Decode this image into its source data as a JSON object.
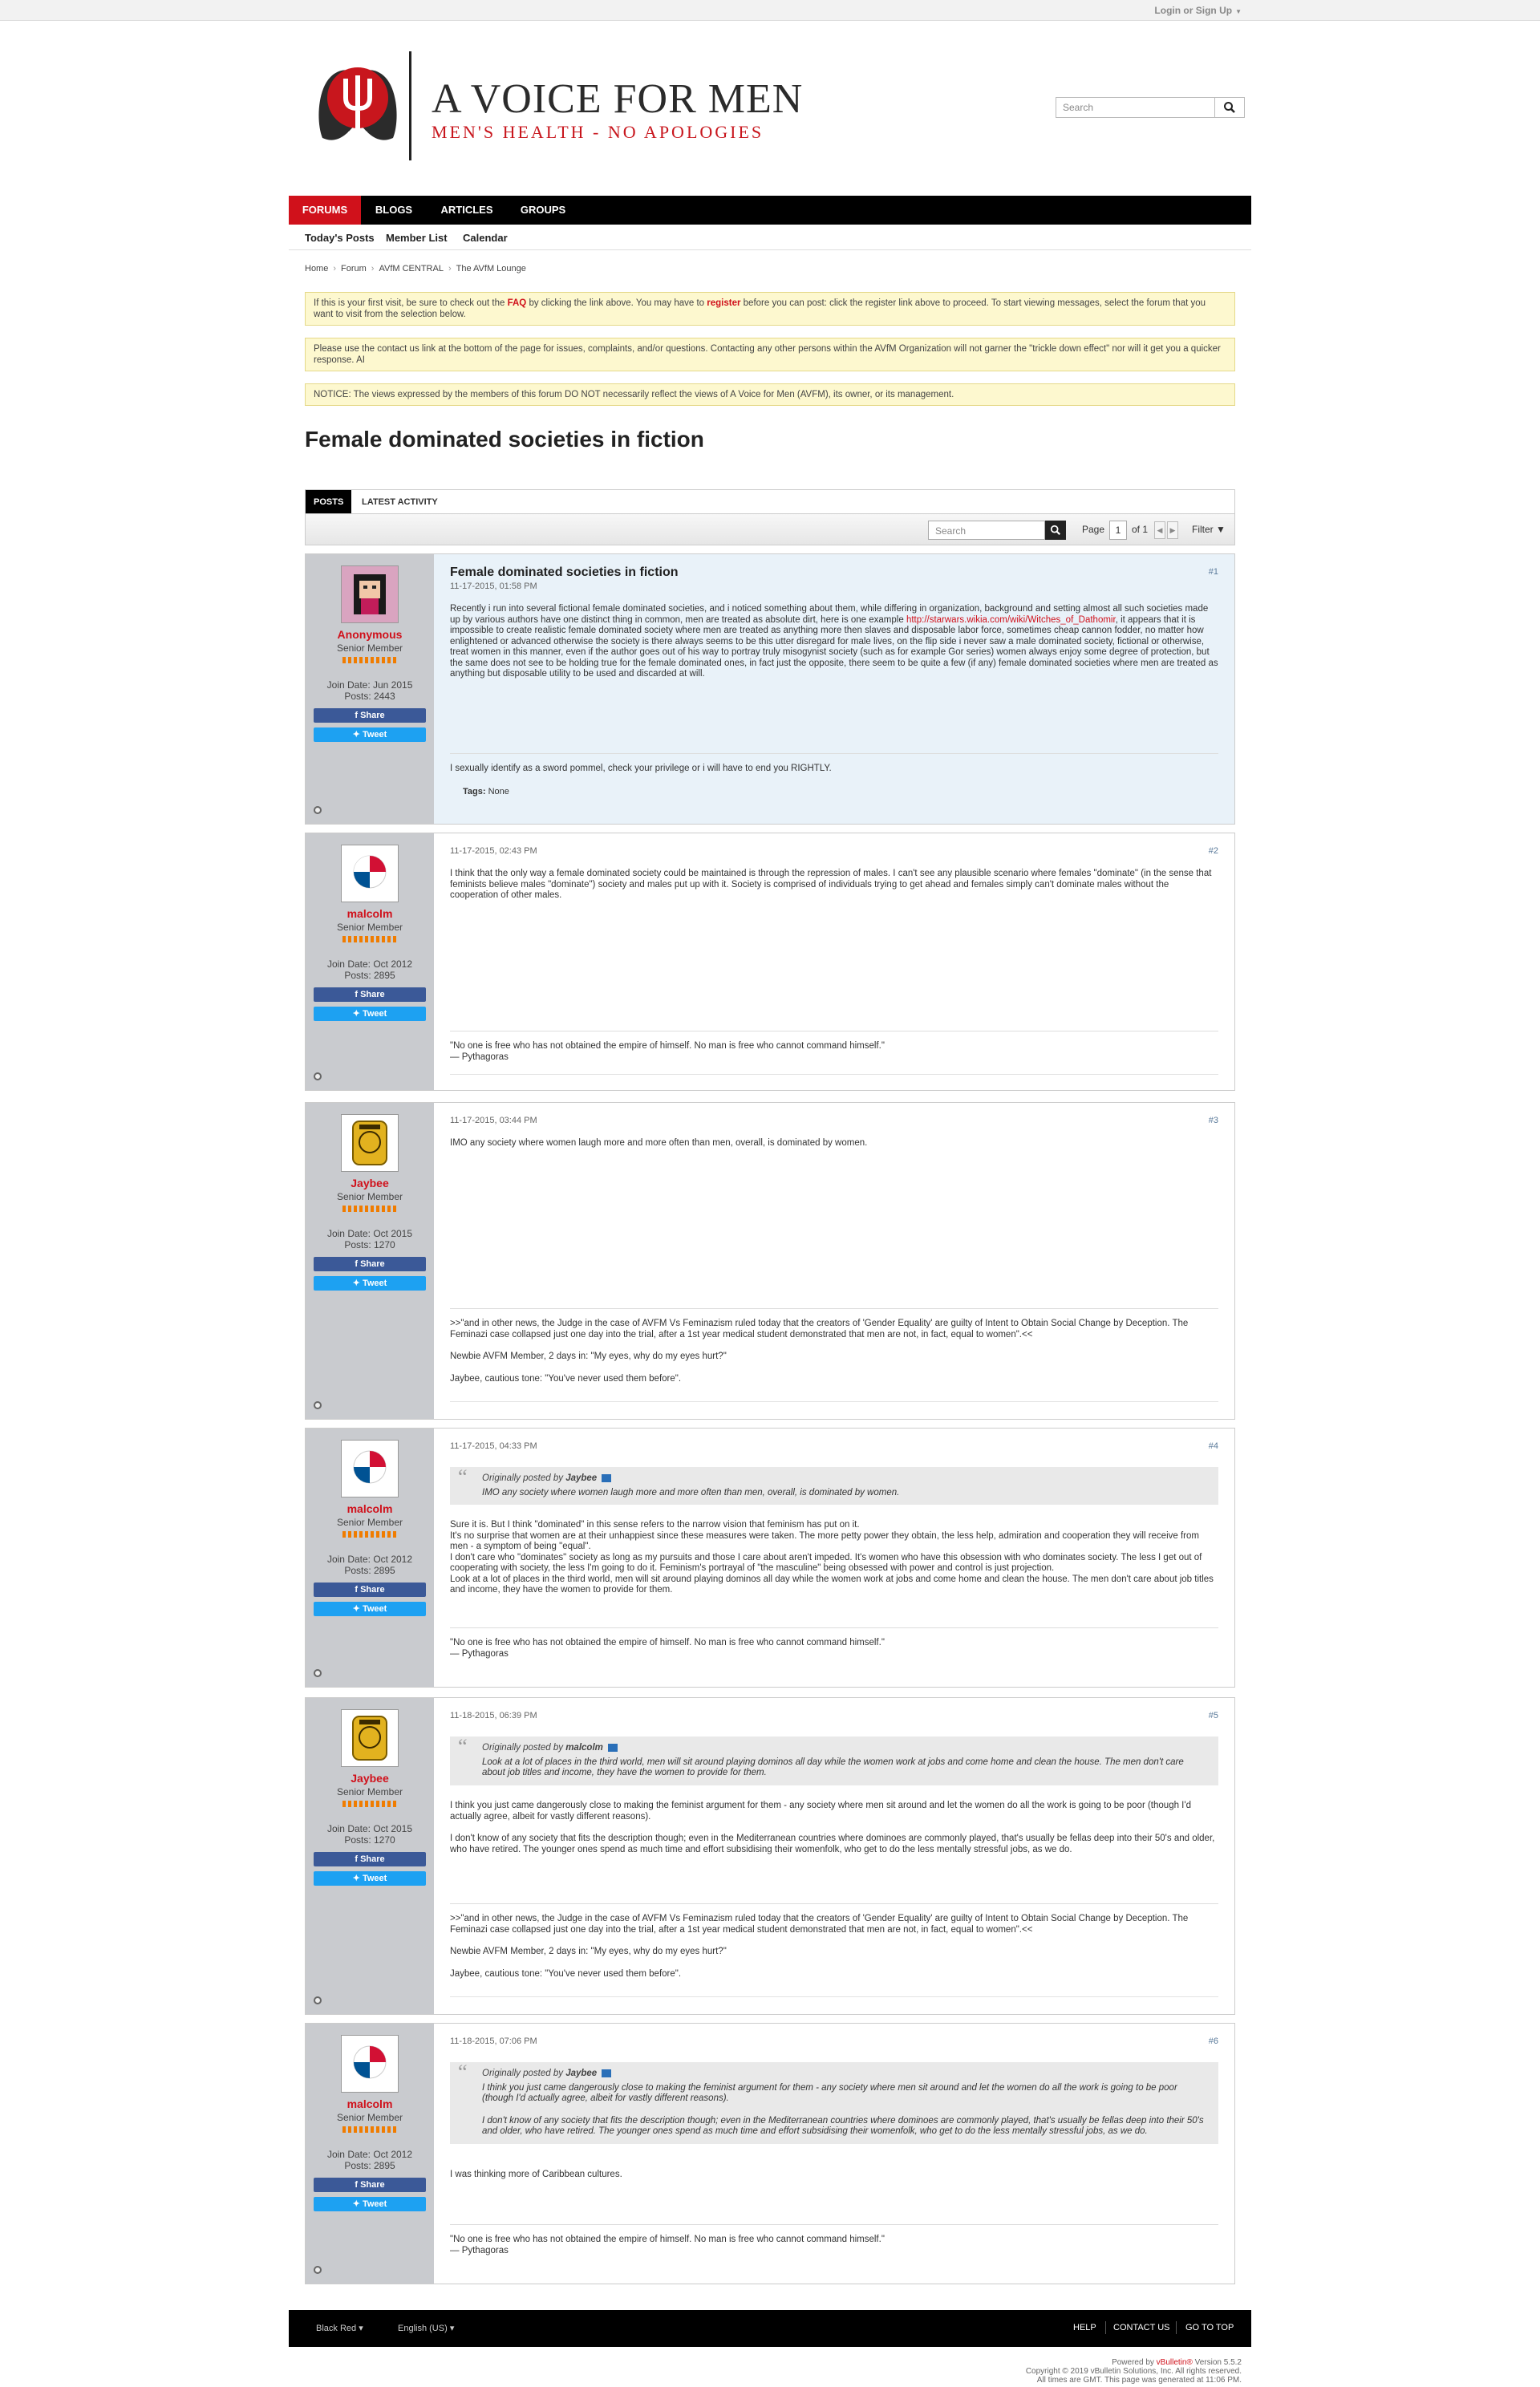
{
  "topbar": {
    "login": "Login or Sign Up"
  },
  "header": {
    "site_name": "A VOICE FOR MEN",
    "tagline": "MEN'S HEALTH - NO APOLOGIES",
    "search_placeholder": "Search"
  },
  "nav": {
    "items": [
      "FORUMS",
      "BLOGS",
      "ARTICLES",
      "GROUPS"
    ],
    "sub": [
      "Today's Posts",
      "Member List",
      "Calendar"
    ]
  },
  "breadcrumb": [
    "Home",
    "Forum",
    "AVfM CENTRAL",
    "The AVfM Lounge"
  ],
  "notices": {
    "n1_a": "If this is your first visit, be sure to check out the ",
    "n1_faq": "FAQ",
    "n1_b": " by clicking the link above. You may have to ",
    "n1_register": "register",
    "n1_c": " before you can post: click the register link above to proceed. To start viewing messages, select the forum that you want to visit from the selection below.",
    "n2": "Please use the contact us link at the bottom of the page for issues, complaints, and/or questions. Contacting any other persons within the AVfM Organization will not garner the \"trickle down effect\" nor will it get you a quicker response. AI",
    "n3": "NOTICE: The views expressed by the members of this forum DO NOT necessarily reflect the views of A Voice for Men (AVFM), its owner, or its management."
  },
  "thread_title": "Female dominated societies in fiction",
  "tabs": [
    "POSTS",
    "LATEST ACTIVITY"
  ],
  "toolbar": {
    "search_placeholder": "Search",
    "page_label": "Page",
    "page_value": "1",
    "of_label": "of 1",
    "filter": "Filter"
  },
  "posts": [
    {
      "user": "Anonymous",
      "rank": "Senior Member",
      "join": "Join Date: Jun 2015",
      "count": "Posts: 2443",
      "title": "Female dominated societies in fiction",
      "date": "11-17-2015, 01:58 PM",
      "num": "#1",
      "body_a": "Recently i run into several fictional female dominated societies, and i noticed something about them, while differing in organization, background and setting almost all such societies made up by various authors have one distinct thing in common, men are treated as absolute dirt, here is one example ",
      "body_link": "http://starwars.wikia.com/wiki/Witches_of_Dathomir",
      "body_b": ", it appears that it is impossible to create realistic female dominated society where men are treated as anything more then slaves and disposable labor force, sometimes cheap cannon fodder, no matter how enlightened or advanced otherwise the society is there always seems to be this utter disregard for male lives, on the flip side i never saw a male dominated society, fictional or otherwise, treat women in this manner, even if the author goes out of his way to portray truly misogynist society (such as for example Gor series) women always enjoy some degree of protection, but the same does not see to be holding true for the female dominated ones, in fact just the opposite, there seem to be quite a few (if any) female dominated societies where men are treated as anything but disposable utility to be used and discarded at will.",
      "sig": "I sexually identify as a sword pommel, check your privilege or i will have to end you RIGHTLY.",
      "tags_label": "Tags:",
      "tags_value": "None"
    },
    {
      "user": "malcolm",
      "rank": "Senior Member",
      "join": "Join Date: Oct 2012",
      "count": "Posts: 2895",
      "date": "11-17-2015, 02:43 PM",
      "num": "#2",
      "body": "I think that the only way a female dominated society could be maintained is through the repression of males. I can't see any plausible scenario where females \"dominate\" (in the sense that feminists believe males \"dominate\") society and males put up with it. Society is comprised of individuals trying to get ahead and females simply can't dominate males without the cooperation of other males.",
      "sig1": "\"No one is free who has not obtained the empire of himself. No man is free who cannot command himself.\"",
      "sig2": "— Pythagoras"
    },
    {
      "user": "Jaybee",
      "rank": "Senior Member",
      "join": "Join Date: Oct 2015",
      "count": "Posts: 1270",
      "date": "11-17-2015, 03:44 PM",
      "num": "#3",
      "body": "IMO any society where women laugh more and more often than men, overall, is dominated by women.",
      "sig1": ">>\"and in other news, the Judge in the case of AVFM Vs Feminazism ruled today that the creators of 'Gender Equality' are guilty of Intent to Obtain Social Change by Deception. The Feminazi case collapsed just one day into the trial, after a 1st year medical student demonstrated that men are not, in fact, equal to women\".<<",
      "sig2": "Newbie AVFM Member, 2 days in: \"My eyes, why do my eyes hurt?\"",
      "sig3": "Jaybee, cautious tone: \"You've never used them before\"."
    },
    {
      "user": "malcolm",
      "rank": "Senior Member",
      "join": "Join Date: Oct 2012",
      "count": "Posts: 2895",
      "date": "11-17-2015, 04:33 PM",
      "num": "#4",
      "quote_prefix": "Originally posted by",
      "quote_user": "Jaybee",
      "quote_text": "IMO any society where women laugh more and more often than men, overall, is dominated by women.",
      "body1": "Sure it is. But I think \"dominated\" in this sense refers to the narrow vision that feminism has put on it.",
      "body2": "It's no surprise that women are at their unhappiest since these measures were taken. The more petty power they obtain, the less help, admiration and cooperation they will receive from men - a symptom of being \"equal\".",
      "body3": "I don't care who \"dominates\" society as long as my pursuits and those I care about aren't impeded. It's women who have this obsession with who dominates society. The less I get out of cooperating with society, the less I'm going to do it. Feminism's portrayal of \"the masculine\" being obsessed with power and control is just projection.",
      "body4": "Look at a lot of places in the third world, men will sit around playing dominos all day while the women work at jobs and come home and clean the house. The men don't care about job titles and income, they have the women to provide for them.",
      "sig1": "\"No one is free who has not obtained the empire of himself. No man is free who cannot command himself.\"",
      "sig2": "— Pythagoras"
    },
    {
      "user": "Jaybee",
      "rank": "Senior Member",
      "join": "Join Date: Oct 2015",
      "count": "Posts: 1270",
      "date": "11-18-2015, 06:39 PM",
      "num": "#5",
      "quote_prefix": "Originally posted by",
      "quote_user": "malcolm",
      "quote_text": "Look at a lot of places in the third world, men will sit around playing dominos all day while the women work at jobs and come home and clean the house. The men don't care about job titles and income, they have the women to provide for them.",
      "body1": "I think you just came dangerously close to making the feminist argument for them - any society where men sit around and let the women do all the work is going to be poor (though I'd actually agree, albeit for vastly different reasons).",
      "body2": "I don't know of any society that fits the description though; even in the Mediterranean countries where dominoes are commonly played, that's usually be fellas deep into their 50's and older, who have retired. The younger ones spend as much time and effort subsidising their womenfolk, who get to do the less mentally stressful jobs, as we do.",
      "sig1": ">>\"and in other news, the Judge in the case of AVFM Vs Feminazism ruled today that the creators of 'Gender Equality' are guilty of Intent to Obtain Social Change by Deception. The Feminazi case collapsed just one day into the trial, after a 1st year medical student demonstrated that men are not, in fact, equal to women\".<<",
      "sig2": "Newbie AVFM Member, 2 days in: \"My eyes, why do my eyes hurt?\"",
      "sig3": "Jaybee, cautious tone: \"You've never used them before\"."
    },
    {
      "user": "malcolm",
      "rank": "Senior Member",
      "join": "Join Date: Oct 2012",
      "count": "Posts: 2895",
      "date": "11-18-2015, 07:06 PM",
      "num": "#6",
      "quote_prefix": "Originally posted by",
      "quote_user": "Jaybee",
      "quote_text1": "I think you just came dangerously close to making the feminist argument for them - any society where men sit around and let the women do all the work is going to be poor (though I'd actually agree, albeit for vastly different reasons).",
      "quote_text2": "I don't know of any society that fits the description though; even in the Mediterranean countries where dominoes are commonly played, that's usually be fellas deep into their 50's and older, who have retired. The younger ones spend as much time and effort subsidising their womenfolk, who get to do the less mentally stressful jobs, as we do.",
      "body1": "I was thinking more of Caribbean cultures.",
      "sig1": "\"No one is free who has not obtained the empire of himself. No man is free who cannot command himself.\"",
      "sig2": "— Pythagoras"
    }
  ],
  "share_label": "Share",
  "tweet_label": "Tweet",
  "footer": {
    "style": "Black Red",
    "lang": "English (US)",
    "help": "HELP",
    "contact": "CONTACT US",
    "top": "GO TO TOP",
    "powered_a": "Powered by ",
    "powered_link": "vBulletin®",
    "powered_b": " Version 5.5.2",
    "copyright": "Copyright © 2019 vBulletin Solutions, Inc. All rights reserved.",
    "times": "All times are GMT. This page was generated at 11:06 PM."
  },
  "colors": {
    "brand_red": "#d0111b",
    "nav_black": "#000000",
    "notice_bg": "#fdf8cf"
  }
}
